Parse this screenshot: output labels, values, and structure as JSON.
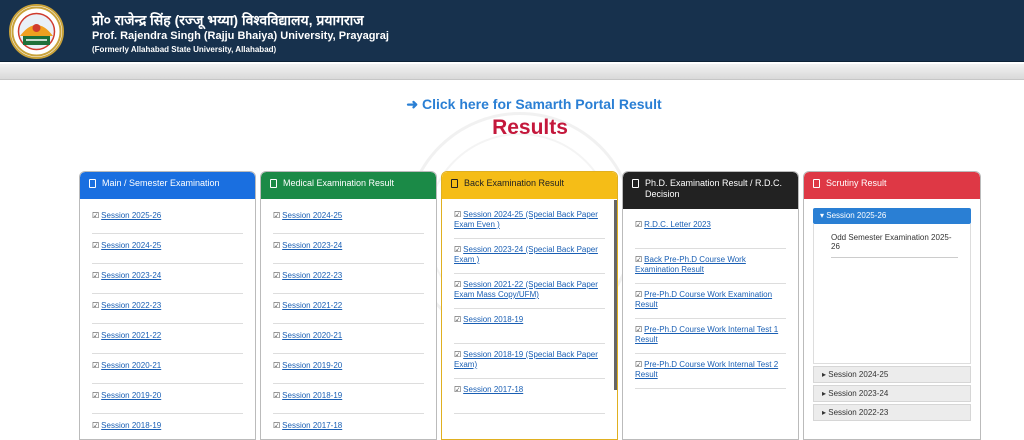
{
  "header": {
    "hindi_name": "प्रो० राजेन्द्र सिंह (रज्जू भय्या) विश्वविद्यालय, प्रयागराज",
    "english_name": "Prof. Rajendra Singh (Rajju Bhaiya) University, Prayagraj",
    "former_name": "(Formerly Allahabad State University, Allahabad)"
  },
  "samarth_link": "➜ Click here for Samarth Portal Result",
  "page_title": "Results",
  "panels": {
    "main": {
      "title": "Main / Semester Examination",
      "color": "#1a6fe0",
      "items": [
        "Session 2025-26",
        "Session 2024-25",
        "Session 2023-24",
        "Session 2022-23",
        "Session 2021-22",
        "Session 2020-21",
        "Session 2019-20",
        "Session 2018-19"
      ]
    },
    "medical": {
      "title": "Medical Examination Result",
      "color": "#1b8a47",
      "items": [
        "Session 2024-25",
        "Session 2023-24",
        "Session 2022-23",
        "Session 2021-22",
        "Session 2020-21",
        "Session 2019-20",
        "Session 2018-19",
        "Session 2017-18"
      ]
    },
    "back": {
      "title": "Back Examination Result",
      "color": "#f5bd17",
      "items": [
        "Session 2024-25 (Special Back Paper Exam Even )",
        "Session 2023-24 (Special Back Paper Exam )",
        "Session 2021-22 (Special Back Paper Exam Mass Copy/UFM)",
        "Session 2018-19",
        "Session 2018-19 (Special Back Paper Exam)",
        "Session 2017-18"
      ]
    },
    "phd": {
      "title": "Ph.D. Examination Result / R.D.C. Decision",
      "color": "#222222",
      "items": [
        "R.D.C. Letter 2023",
        "Back Pre-Ph.D Course Work Examination Result",
        "Pre-Ph.D Course Work Examination Result",
        "Pre-Ph.D Course Work Internal Test 1 Result",
        "Pre-Ph.D Course Work Internal Test 2 Result"
      ]
    },
    "scrutiny": {
      "title": "Scrutiny Result",
      "color": "#de3845",
      "active_session": "Session 2025-26",
      "active_content": "Odd Semester Examination 2025-26",
      "sessions": [
        "Session 2024-25",
        "Session 2023-24",
        "Session 2022-23"
      ]
    }
  }
}
